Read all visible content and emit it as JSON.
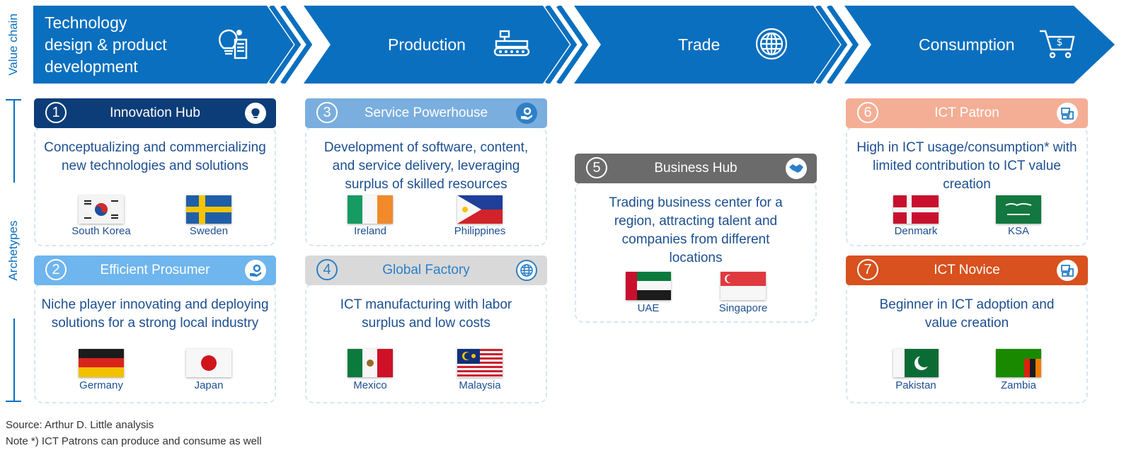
{
  "axis": {
    "value_chain": "Value chain",
    "archetypes": "Archetypes"
  },
  "chain": {
    "stages": [
      {
        "label": "Technology design & product development",
        "lines": [
          "Technology",
          "design & product",
          "development"
        ],
        "icon": "lightbulb-gear-icon"
      },
      {
        "label": "Production",
        "icon": "factory-conveyor-icon"
      },
      {
        "label": "Trade",
        "icon": "globe-icon"
      },
      {
        "label": "Consumption",
        "icon": "shopping-cart-dollar-icon"
      }
    ]
  },
  "colors": {
    "chain_blue": "#0a6fbf",
    "innovation_hub": "#0d3d78",
    "efficient_prosumer": "#6fb5ee",
    "service_powerhouse": "#7aaede",
    "global_factory": "#d9d9d9",
    "business_hub": "#6b6b6b",
    "ict_patron": "#f4ae96",
    "ict_novice": "#d8511f"
  },
  "archetypes": [
    {
      "num": "1",
      "title": "Innovation Hub",
      "icon": "lightbulb-icon",
      "description": "Conceptualizing and commercializing new technologies and solutions",
      "countries": [
        "South Korea",
        "Sweden"
      ]
    },
    {
      "num": "2",
      "title": "Efficient Prosumer",
      "icon": "hand-gear-icon",
      "description": "Niche player innovating and deploying solutions for a strong local industry",
      "countries": [
        "Germany",
        "Japan"
      ]
    },
    {
      "num": "3",
      "title": "Service Powerhouse",
      "icon": "hand-gear-icon",
      "description": "Development of software, content, and service delivery, leveraging surplus of skilled resources",
      "countries": [
        "Ireland",
        "Philippines"
      ]
    },
    {
      "num": "4",
      "title": "Global Factory",
      "icon": "globe-icon",
      "description": "ICT manufacturing with labor surplus and low costs",
      "countries": [
        "Mexico",
        "Malaysia"
      ]
    },
    {
      "num": "5",
      "title": "Business Hub",
      "icon": "handshake-icon",
      "description": "Trading business center for a region, attracting talent and companies from different locations",
      "countries": [
        "UAE",
        "Singapore"
      ]
    },
    {
      "num": "6",
      "title": "ICT Patron",
      "icon": "devices-icon",
      "description": "High in ICT usage/consumption* with limited contribution to ICT value creation",
      "countries": [
        "Denmark",
        "KSA"
      ]
    },
    {
      "num": "7",
      "title": "ICT Novice",
      "icon": "devices-icon",
      "description": "Beginner in ICT adoption and value creation",
      "countries": [
        "Pakistan",
        "Zambia"
      ]
    }
  ],
  "footer": {
    "source": "Source: Arthur D. Little analysis",
    "note": "Note *) ICT Patrons can produce and consume as well"
  }
}
